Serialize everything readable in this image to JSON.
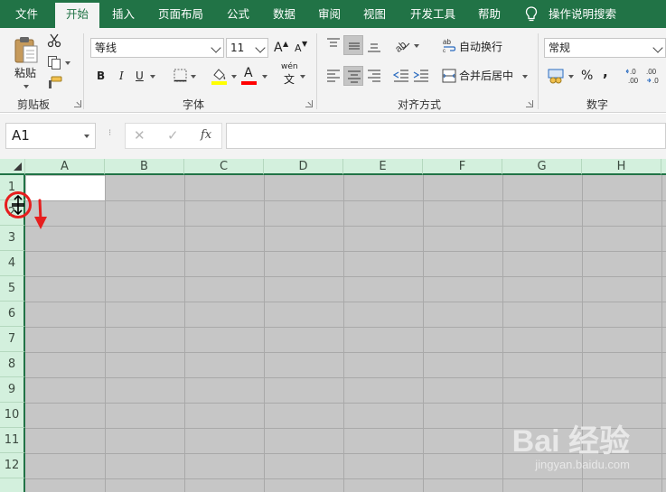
{
  "ribbon_tabs": [
    "文件",
    "开始",
    "插入",
    "页面布局",
    "公式",
    "数据",
    "审阅",
    "视图",
    "开发工具",
    "帮助"
  ],
  "tell_me": "操作说明搜索",
  "clipboard": {
    "paste_label": "粘贴",
    "group_label": "剪贴板"
  },
  "font": {
    "name": "等线",
    "size": "11",
    "grow": "A",
    "shrink": "A",
    "bold": "B",
    "italic": "I",
    "underline": "U",
    "font_color_letter": "A",
    "phonetic": "wén",
    "phonetic_char": "文",
    "group_label": "字体",
    "highlight_color": "#ffff00",
    "text_color": "#ff0000"
  },
  "alignment": {
    "wrap_text": "自动换行",
    "merge_center": "合并后居中",
    "group_label": "对齐方式"
  },
  "number": {
    "format": "常规",
    "percent": "%",
    "comma": ",",
    "group_label": "数字",
    "inc_decimal": "←.0\n.00",
    "dec_decimal": ".00\n→.0"
  },
  "formula_bar": {
    "name_box": "A1",
    "cancel": "✕",
    "enter": "✓",
    "fx": "fx",
    "value": ""
  },
  "sheet": {
    "columns": [
      "A",
      "B",
      "C",
      "D",
      "E",
      "F",
      "G",
      "H"
    ],
    "rows": [
      "1",
      "2",
      "3",
      "4",
      "5",
      "6",
      "7",
      "8",
      "9",
      "10",
      "11",
      "12"
    ]
  },
  "watermark": {
    "text": "Bai 经验",
    "url": "jingyan.baidu.com"
  },
  "colors": {
    "accent": "#217346",
    "header_bg": "#d3f0dd",
    "selection": "#c6c6c6",
    "annotation": "#e61e1e"
  }
}
